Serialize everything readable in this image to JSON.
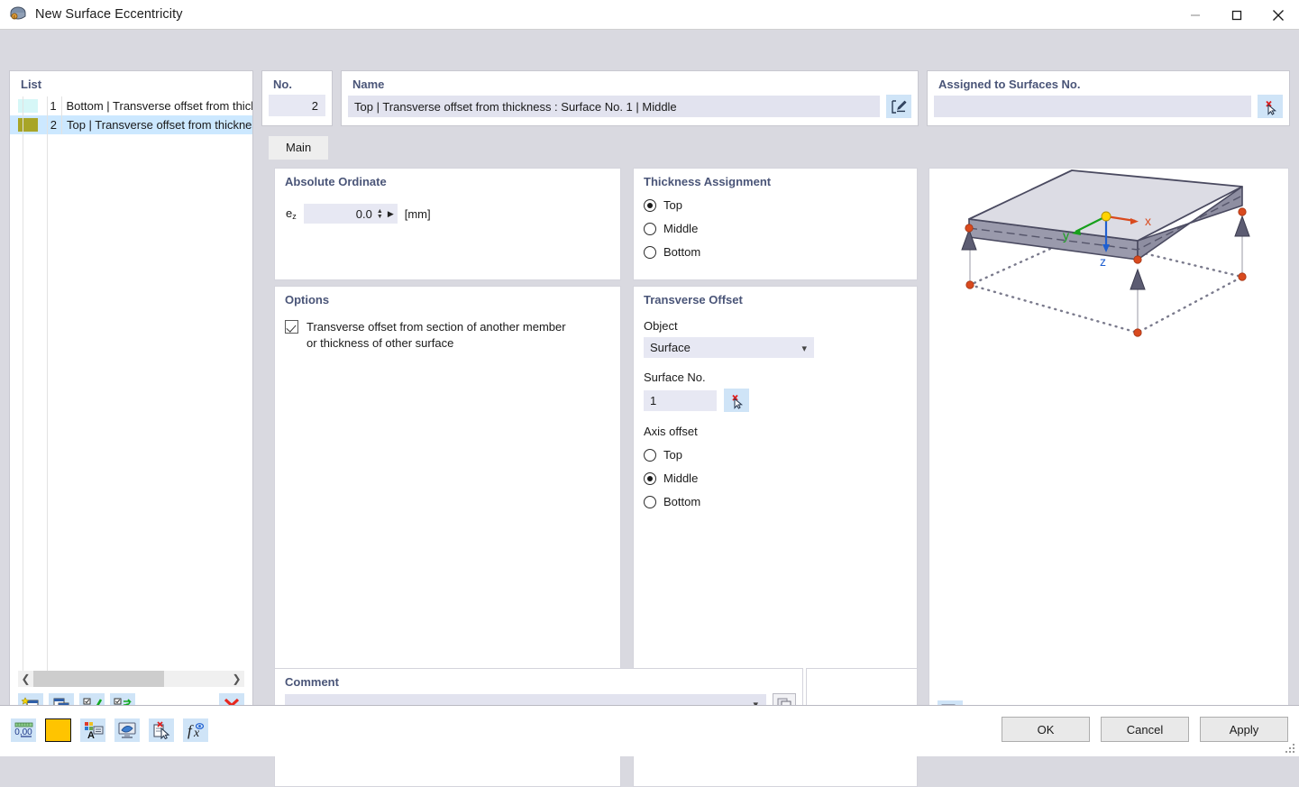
{
  "window": {
    "title": "New Surface Eccentricity",
    "icon": "app-icon",
    "minimize_label": "—",
    "maximize_label": "☐",
    "close_label": "✕"
  },
  "list": {
    "header": "List",
    "items": [
      {
        "num": "1",
        "label": "Bottom | Transverse offset from thickne",
        "color": "#d6f7f7",
        "selected": false
      },
      {
        "num": "2",
        "label": "Top | Transverse offset from thickness",
        "color": "#a8a527",
        "selected": true
      }
    ],
    "scroll_left_icon": "chevron-left-icon",
    "scroll_right_icon": "chevron-right-icon",
    "toolbar": {
      "new_icon": "new-item-icon",
      "copy_icon": "copy-item-icon",
      "select_all_icon": "select-all-icon",
      "invert_icon": "invert-selection-icon",
      "delete_icon": "delete-icon"
    }
  },
  "no_panel": {
    "header": "No.",
    "value": "2"
  },
  "name_panel": {
    "header": "Name",
    "value": "Top | Transverse offset from thickness : Surface No. 1 | Middle",
    "edit_icon": "edit-name-icon"
  },
  "assigned_panel": {
    "header": "Assigned to Surfaces No.",
    "value": "",
    "pick_icon": "pick-deselect-icon"
  },
  "tabs": [
    {
      "label": "Main",
      "active": true
    }
  ],
  "absolute_ordinate": {
    "title": "Absolute Ordinate",
    "label": "e",
    "label_sub": "z",
    "value": "0.0",
    "unit": "[mm]",
    "spin_up_icon": "spin-up-icon",
    "spin_down_icon": "spin-down-icon",
    "play_icon": "play-arrow-icon"
  },
  "thickness_assignment": {
    "title": "Thickness Assignment",
    "options": [
      {
        "label": "Top",
        "selected": true
      },
      {
        "label": "Middle",
        "selected": false
      },
      {
        "label": "Bottom",
        "selected": false
      }
    ]
  },
  "options": {
    "title": "Options",
    "checkbox": {
      "line1": "Transverse offset from section of another member",
      "line2": "or thickness of other surface",
      "checked": true
    }
  },
  "transverse_offset": {
    "title": "Transverse Offset",
    "object_label": "Object",
    "object_value": "Surface",
    "object_chevron": "chevron-down-icon",
    "surface_no_label": "Surface No.",
    "surface_no_value": "1",
    "surface_pick_icon": "pick-deselect-icon",
    "axis_offset_label": "Axis offset",
    "axis_options": [
      {
        "label": "Top",
        "selected": false
      },
      {
        "label": "Middle",
        "selected": true
      },
      {
        "label": "Bottom",
        "selected": false
      }
    ]
  },
  "comment": {
    "title": "Comment",
    "value": "",
    "chevron": "chevron-down-icon",
    "picker_icon": "comment-template-icon"
  },
  "viewport": {
    "render_icon": "render-settings-icon",
    "axes": [
      {
        "name": "x",
        "color": "#d94a1e"
      },
      {
        "name": "y",
        "color": "#17a01b"
      },
      {
        "name": "z",
        "color": "#1f5fd0"
      }
    ],
    "origin_color": "#ffd400",
    "node_color": "#d94a1e",
    "surface_fill": "#dcdce4",
    "surface_edge": "#4a4a60"
  },
  "statusbar_icons": [
    "numeric-format-icon",
    "color-swatch-icon",
    "text-style-icon",
    "view-display-icon",
    "clear-selection-icon",
    "formula-icon"
  ],
  "dialog_buttons": [
    {
      "label": "OK"
    },
    {
      "label": "Cancel"
    },
    {
      "label": "Apply"
    }
  ]
}
